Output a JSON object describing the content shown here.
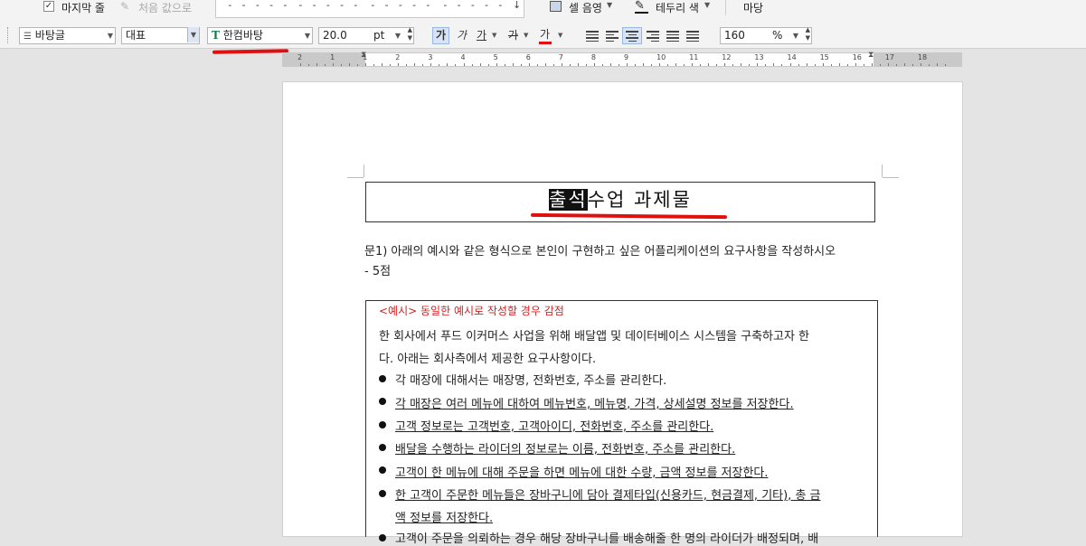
{
  "ribbon": {
    "last_row_label": "마지막 줄",
    "last_row_checked": true,
    "reset_label": "처음 값으로",
    "gallery_samples": [
      "- - - - -",
      "- - - - -",
      "- - - - -",
      "- - - - -"
    ],
    "cell_shade_label": "셀 음영",
    "border_color_label": "테두리 색",
    "margin_label": "마당"
  },
  "toolbar": {
    "style_select": "바탕글",
    "para_select": "대표",
    "font_select": "한컴바탕",
    "font_size": "20.0",
    "font_unit": "pt",
    "bold_glyph": "가",
    "italic_glyph": "가",
    "underline_glyph": "가",
    "strike_glyph": "가",
    "color_glyph": "가",
    "zoom": "160",
    "zoom_unit": "%"
  },
  "ruler": {
    "numbers": [
      "2",
      "1",
      "1",
      "2",
      "3",
      "4",
      "5",
      "6",
      "7",
      "8",
      "9",
      "10",
      "11",
      "12",
      "13",
      "14",
      "15",
      "16",
      "17",
      "18"
    ]
  },
  "document": {
    "title_highlight": "출석",
    "title_rest": "수업 과제물",
    "question_line1": "문1) 아래의 예시와 같은 형식으로 본인이 구현하고 싶은 어플리케이션의 요구사항을 작성하시오",
    "question_line2": "- 5점",
    "example_header": "<예시> 동일한 예시로 작성할 경우 감점",
    "intro_line1": "한 회사에서 푸드 이커머스 사업을 위해 배달앱 및 데이터베이스 시스템을 구축하고자 한",
    "intro_line2": "다. 아래는 회사측에서 제공한 요구사항이다.",
    "bullets": [
      "각 매장에 대해서는 매장명, 전화번호, 주소를 관리한다.",
      "각 매장은 여러 메뉴에 대하여 메뉴번호, 메뉴명, 가격, 상세설명 정보를 저장한다.",
      "고객 정보로는 고객번호, 고객아이디, 전화번호, 주소를 관리한다.",
      "배달을 수행하는 라이더의 정보로는 이름, 전화번호, 주소를 관리한다.",
      "고객이 한 메뉴에 대해 주문을 하면 메뉴에 대한 수량, 금액 정보를 저장한다.",
      "한 고객이 주문한 메뉴들은 장바구니에 담아 결제타입(신용카드, 현금결제, 기타), 총 금"
    ],
    "bullet6_cont": "액 정보를 저장한다.",
    "bullet7_partial": "고객이 주문을 의뢰하는 경우 해당 장바구니를 배송해줄 한 명의 라이더가 배정되며, 배"
  },
  "colors": {
    "accent_red": "#e01010",
    "example_red": "#d42020",
    "active_blue": "#d6e4f5"
  }
}
